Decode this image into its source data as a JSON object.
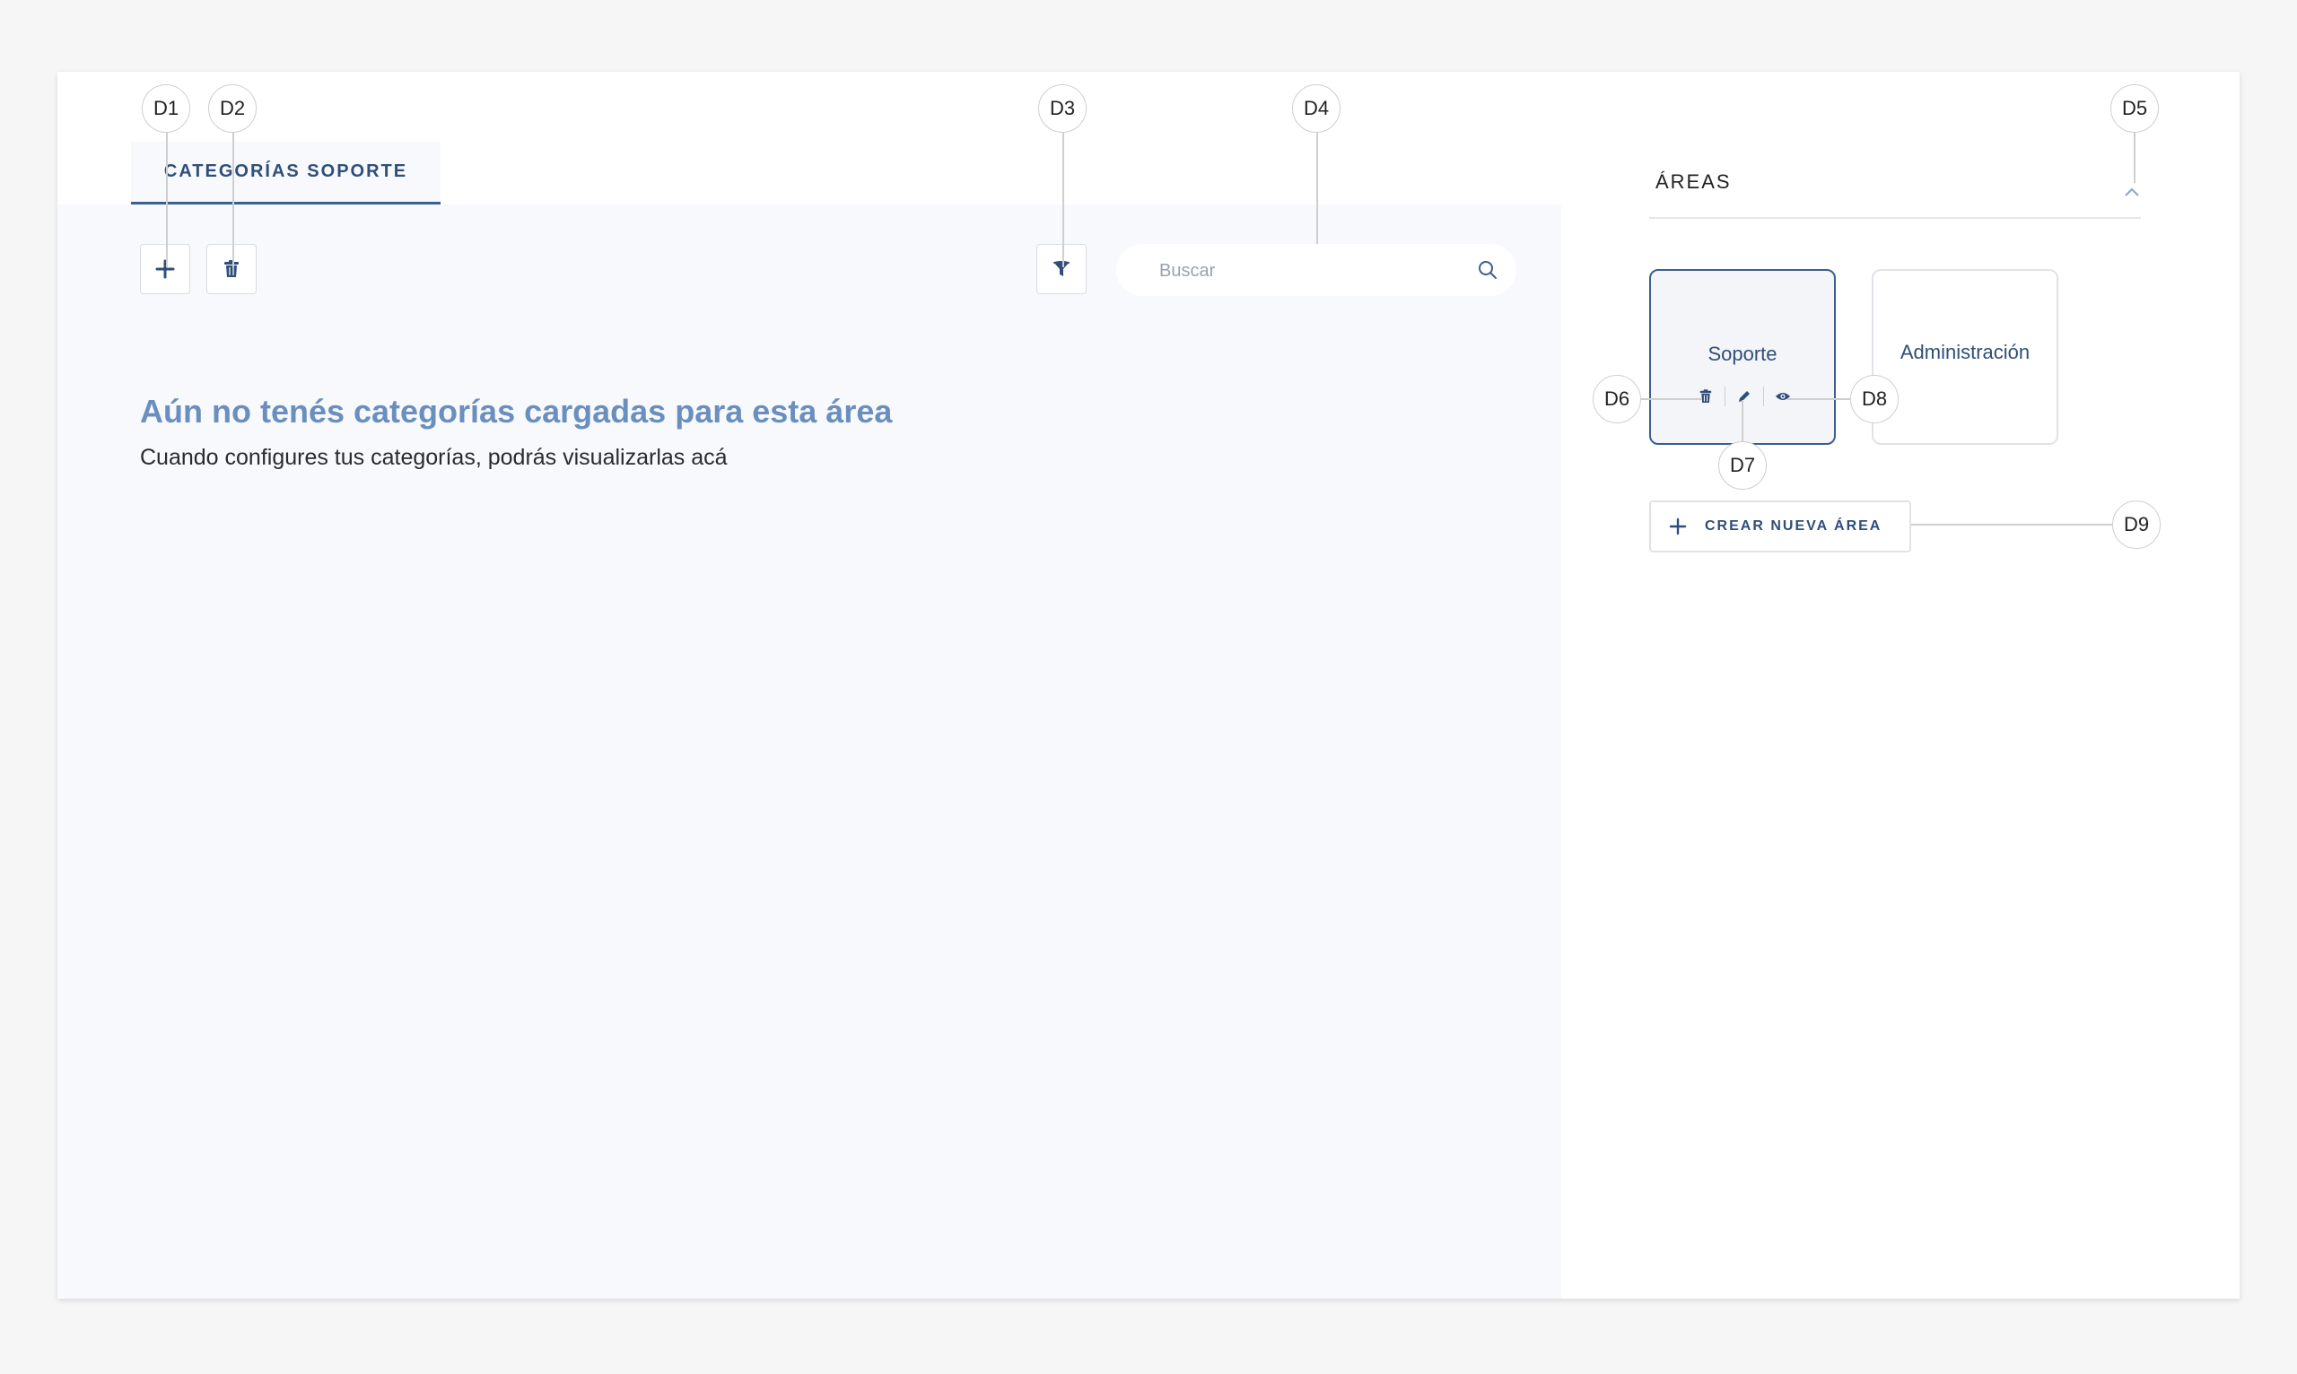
{
  "tab": {
    "label": "CATEGORÍAS SOPORTE"
  },
  "toolbar": {
    "add_icon": "plus-icon",
    "delete_icon": "trash-icon",
    "filter_icon": "filter-icon"
  },
  "search": {
    "placeholder": "Buscar",
    "value": "",
    "icon": "search-icon"
  },
  "empty_state": {
    "title": "Aún no tenés categorías cargadas para esta área",
    "subtitle": "Cuando configures tus categorías, podrás visualizarlas acá"
  },
  "areas_panel": {
    "title": "ÁREAS",
    "collapse_icon": "chevron-up-icon",
    "cards": [
      {
        "name": "Soporte",
        "selected": true,
        "actions": [
          "trash-icon",
          "pencil-icon",
          "eye-icon"
        ]
      },
      {
        "name": "Administración",
        "selected": false
      }
    ],
    "create_button": {
      "label": "CREAR NUEVA ÁREA",
      "icon": "plus-icon"
    }
  },
  "annotations": {
    "d1": "D1",
    "d2": "D2",
    "d3": "D3",
    "d4": "D4",
    "d5": "D5",
    "d6": "D6",
    "d7": "D7",
    "d8": "D8",
    "d9": "D9"
  },
  "colors": {
    "accent": "#2f4e79",
    "accent_light": "#6a8fbf",
    "panel_bg": "#f7f9fc",
    "border": "#d7dce4"
  }
}
